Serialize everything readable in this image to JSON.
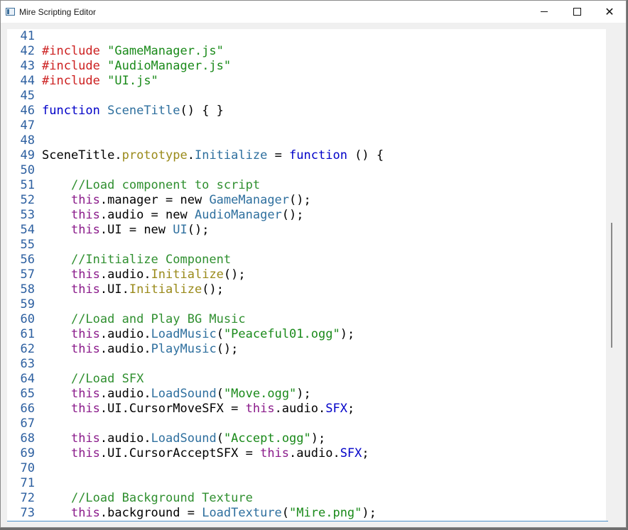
{
  "window": {
    "title": "Mire Scripting Editor",
    "controls": {
      "minimize": "minimize",
      "maximize": "maximize",
      "close": "✕"
    }
  },
  "colors": {
    "keyword": "#0000c8",
    "directive": "#cc1f1f",
    "string": "#1a8a1a",
    "comment": "#2f8f2f",
    "this": "#8a1a8a",
    "property": "#9a8a1a",
    "method": "#2e6f9e",
    "line_number": "#2c5fa0"
  },
  "editor": {
    "lines": [
      {
        "n": "41",
        "tokens": []
      },
      {
        "n": "42",
        "tokens": [
          {
            "t": "dir",
            "v": "#include"
          },
          {
            "t": "plain",
            "v": " "
          },
          {
            "t": "str",
            "v": "\"GameManager.js\""
          }
        ]
      },
      {
        "n": "43",
        "tokens": [
          {
            "t": "dir",
            "v": "#include"
          },
          {
            "t": "plain",
            "v": " "
          },
          {
            "t": "str",
            "v": "\"AudioManager.js\""
          }
        ]
      },
      {
        "n": "44",
        "tokens": [
          {
            "t": "dir",
            "v": "#include"
          },
          {
            "t": "plain",
            "v": " "
          },
          {
            "t": "str",
            "v": "\"UI.js\""
          }
        ]
      },
      {
        "n": "45",
        "tokens": []
      },
      {
        "n": "46",
        "tokens": [
          {
            "t": "kw",
            "v": "function"
          },
          {
            "t": "plain",
            "v": " "
          },
          {
            "t": "cls",
            "v": "SceneTitle"
          },
          {
            "t": "plain",
            "v": "() { }"
          }
        ]
      },
      {
        "n": "47",
        "tokens": []
      },
      {
        "n": "48",
        "tokens": []
      },
      {
        "n": "49",
        "tokens": [
          {
            "t": "plain",
            "v": "SceneTitle."
          },
          {
            "t": "prop",
            "v": "prototype"
          },
          {
            "t": "plain",
            "v": "."
          },
          {
            "t": "method",
            "v": "Initialize"
          },
          {
            "t": "plain",
            "v": " = "
          },
          {
            "t": "kw",
            "v": "function"
          },
          {
            "t": "plain",
            "v": " () {"
          }
        ]
      },
      {
        "n": "50",
        "tokens": []
      },
      {
        "n": "51",
        "tokens": [
          {
            "t": "plain",
            "v": "    "
          },
          {
            "t": "com",
            "v": "//Load component to script"
          }
        ]
      },
      {
        "n": "52",
        "tokens": [
          {
            "t": "plain",
            "v": "    "
          },
          {
            "t": "this",
            "v": "this"
          },
          {
            "t": "plain",
            "v": ".manager = new "
          },
          {
            "t": "cls",
            "v": "GameManager"
          },
          {
            "t": "plain",
            "v": "();"
          }
        ]
      },
      {
        "n": "53",
        "tokens": [
          {
            "t": "plain",
            "v": "    "
          },
          {
            "t": "this",
            "v": "this"
          },
          {
            "t": "plain",
            "v": ".audio = new "
          },
          {
            "t": "cls",
            "v": "AudioManager"
          },
          {
            "t": "plain",
            "v": "();"
          }
        ]
      },
      {
        "n": "54",
        "tokens": [
          {
            "t": "plain",
            "v": "    "
          },
          {
            "t": "this",
            "v": "this"
          },
          {
            "t": "plain",
            "v": ".UI = new "
          },
          {
            "t": "cls",
            "v": "UI"
          },
          {
            "t": "plain",
            "v": "();"
          }
        ]
      },
      {
        "n": "55",
        "tokens": []
      },
      {
        "n": "56",
        "tokens": [
          {
            "t": "plain",
            "v": "    "
          },
          {
            "t": "com",
            "v": "//Initialize Component"
          }
        ]
      },
      {
        "n": "57",
        "tokens": [
          {
            "t": "plain",
            "v": "    "
          },
          {
            "t": "this",
            "v": "this"
          },
          {
            "t": "plain",
            "v": ".audio."
          },
          {
            "t": "prop",
            "v": "Initialize"
          },
          {
            "t": "plain",
            "v": "();"
          }
        ]
      },
      {
        "n": "58",
        "tokens": [
          {
            "t": "plain",
            "v": "    "
          },
          {
            "t": "this",
            "v": "this"
          },
          {
            "t": "plain",
            "v": ".UI."
          },
          {
            "t": "prop",
            "v": "Initialize"
          },
          {
            "t": "plain",
            "v": "();"
          }
        ]
      },
      {
        "n": "59",
        "tokens": []
      },
      {
        "n": "60",
        "tokens": [
          {
            "t": "plain",
            "v": "    "
          },
          {
            "t": "com",
            "v": "//Load and Play BG Music"
          }
        ]
      },
      {
        "n": "61",
        "tokens": [
          {
            "t": "plain",
            "v": "    "
          },
          {
            "t": "this",
            "v": "this"
          },
          {
            "t": "plain",
            "v": ".audio."
          },
          {
            "t": "method",
            "v": "LoadMusic"
          },
          {
            "t": "plain",
            "v": "("
          },
          {
            "t": "str",
            "v": "\"Peaceful01.ogg\""
          },
          {
            "t": "plain",
            "v": ");"
          }
        ]
      },
      {
        "n": "62",
        "tokens": [
          {
            "t": "plain",
            "v": "    "
          },
          {
            "t": "this",
            "v": "this"
          },
          {
            "t": "plain",
            "v": ".audio."
          },
          {
            "t": "method",
            "v": "PlayMusic"
          },
          {
            "t": "plain",
            "v": "();"
          }
        ]
      },
      {
        "n": "63",
        "tokens": []
      },
      {
        "n": "64",
        "tokens": [
          {
            "t": "plain",
            "v": "    "
          },
          {
            "t": "com",
            "v": "//Load SFX"
          }
        ]
      },
      {
        "n": "65",
        "tokens": [
          {
            "t": "plain",
            "v": "    "
          },
          {
            "t": "this",
            "v": "this"
          },
          {
            "t": "plain",
            "v": ".audio."
          },
          {
            "t": "method",
            "v": "LoadSound"
          },
          {
            "t": "plain",
            "v": "("
          },
          {
            "t": "str",
            "v": "\"Move.ogg\""
          },
          {
            "t": "plain",
            "v": ");"
          }
        ]
      },
      {
        "n": "66",
        "tokens": [
          {
            "t": "plain",
            "v": "    "
          },
          {
            "t": "this",
            "v": "this"
          },
          {
            "t": "plain",
            "v": ".UI.CursorMoveSFX = "
          },
          {
            "t": "this",
            "v": "this"
          },
          {
            "t": "plain",
            "v": ".audio."
          },
          {
            "t": "kw",
            "v": "SFX"
          },
          {
            "t": "plain",
            "v": ";"
          }
        ]
      },
      {
        "n": "67",
        "tokens": []
      },
      {
        "n": "68",
        "tokens": [
          {
            "t": "plain",
            "v": "    "
          },
          {
            "t": "this",
            "v": "this"
          },
          {
            "t": "plain",
            "v": ".audio."
          },
          {
            "t": "method",
            "v": "LoadSound"
          },
          {
            "t": "plain",
            "v": "("
          },
          {
            "t": "str",
            "v": "\"Accept.ogg\""
          },
          {
            "t": "plain",
            "v": ");"
          }
        ]
      },
      {
        "n": "69",
        "tokens": [
          {
            "t": "plain",
            "v": "    "
          },
          {
            "t": "this",
            "v": "this"
          },
          {
            "t": "plain",
            "v": ".UI.CursorAcceptSFX = "
          },
          {
            "t": "this",
            "v": "this"
          },
          {
            "t": "plain",
            "v": ".audio."
          },
          {
            "t": "kw",
            "v": "SFX"
          },
          {
            "t": "plain",
            "v": ";"
          }
        ]
      },
      {
        "n": "70",
        "tokens": []
      },
      {
        "n": "71",
        "tokens": []
      },
      {
        "n": "72",
        "tokens": [
          {
            "t": "plain",
            "v": "    "
          },
          {
            "t": "com",
            "v": "//Load Background Texture"
          }
        ]
      },
      {
        "n": "73",
        "tokens": [
          {
            "t": "plain",
            "v": "    "
          },
          {
            "t": "this",
            "v": "this"
          },
          {
            "t": "plain",
            "v": ".background = "
          },
          {
            "t": "method",
            "v": "LoadTexture"
          },
          {
            "t": "plain",
            "v": "("
          },
          {
            "t": "str",
            "v": "\"Mire.png\""
          },
          {
            "t": "plain",
            "v": ");"
          }
        ]
      }
    ]
  }
}
